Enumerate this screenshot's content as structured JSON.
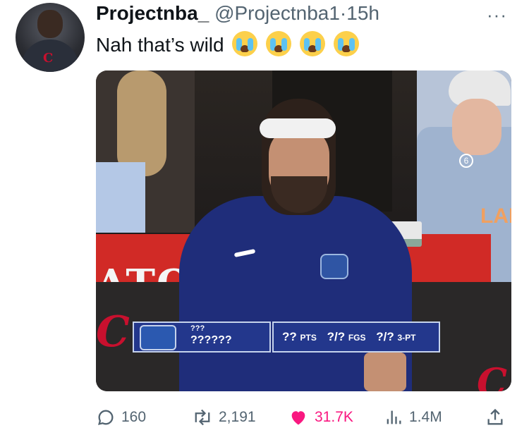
{
  "tweet": {
    "display_name": "Projectnba_",
    "handle": "@Projectnba1",
    "separator": "·",
    "time": "15h",
    "text": "Nah that’s wild",
    "emojis": [
      "loudly-crying-face",
      "loudly-crying-face",
      "loudly-crying-face",
      "loudly-crying-face"
    ],
    "more_icon": "more-horizontal-icon"
  },
  "media": {
    "banner_text": "ATO",
    "jersey_number": "6",
    "jersey_text": "LAND",
    "court_logo": "C",
    "graphic": {
      "line1": "???",
      "line2": "??????",
      "stat_pts_value": "??",
      "stat_pts_label": "PTS",
      "stat_fgs_value": "?/?",
      "stat_fgs_label": "FGS",
      "stat_3pt_value": "?/?",
      "stat_3pt_label": "3-PT"
    }
  },
  "actions": {
    "reply_count": "160",
    "retweet_count": "2,191",
    "like_count": "31.7K",
    "views_count": "1.4M",
    "like_color": "#f91880",
    "icon_color": "#536471"
  }
}
